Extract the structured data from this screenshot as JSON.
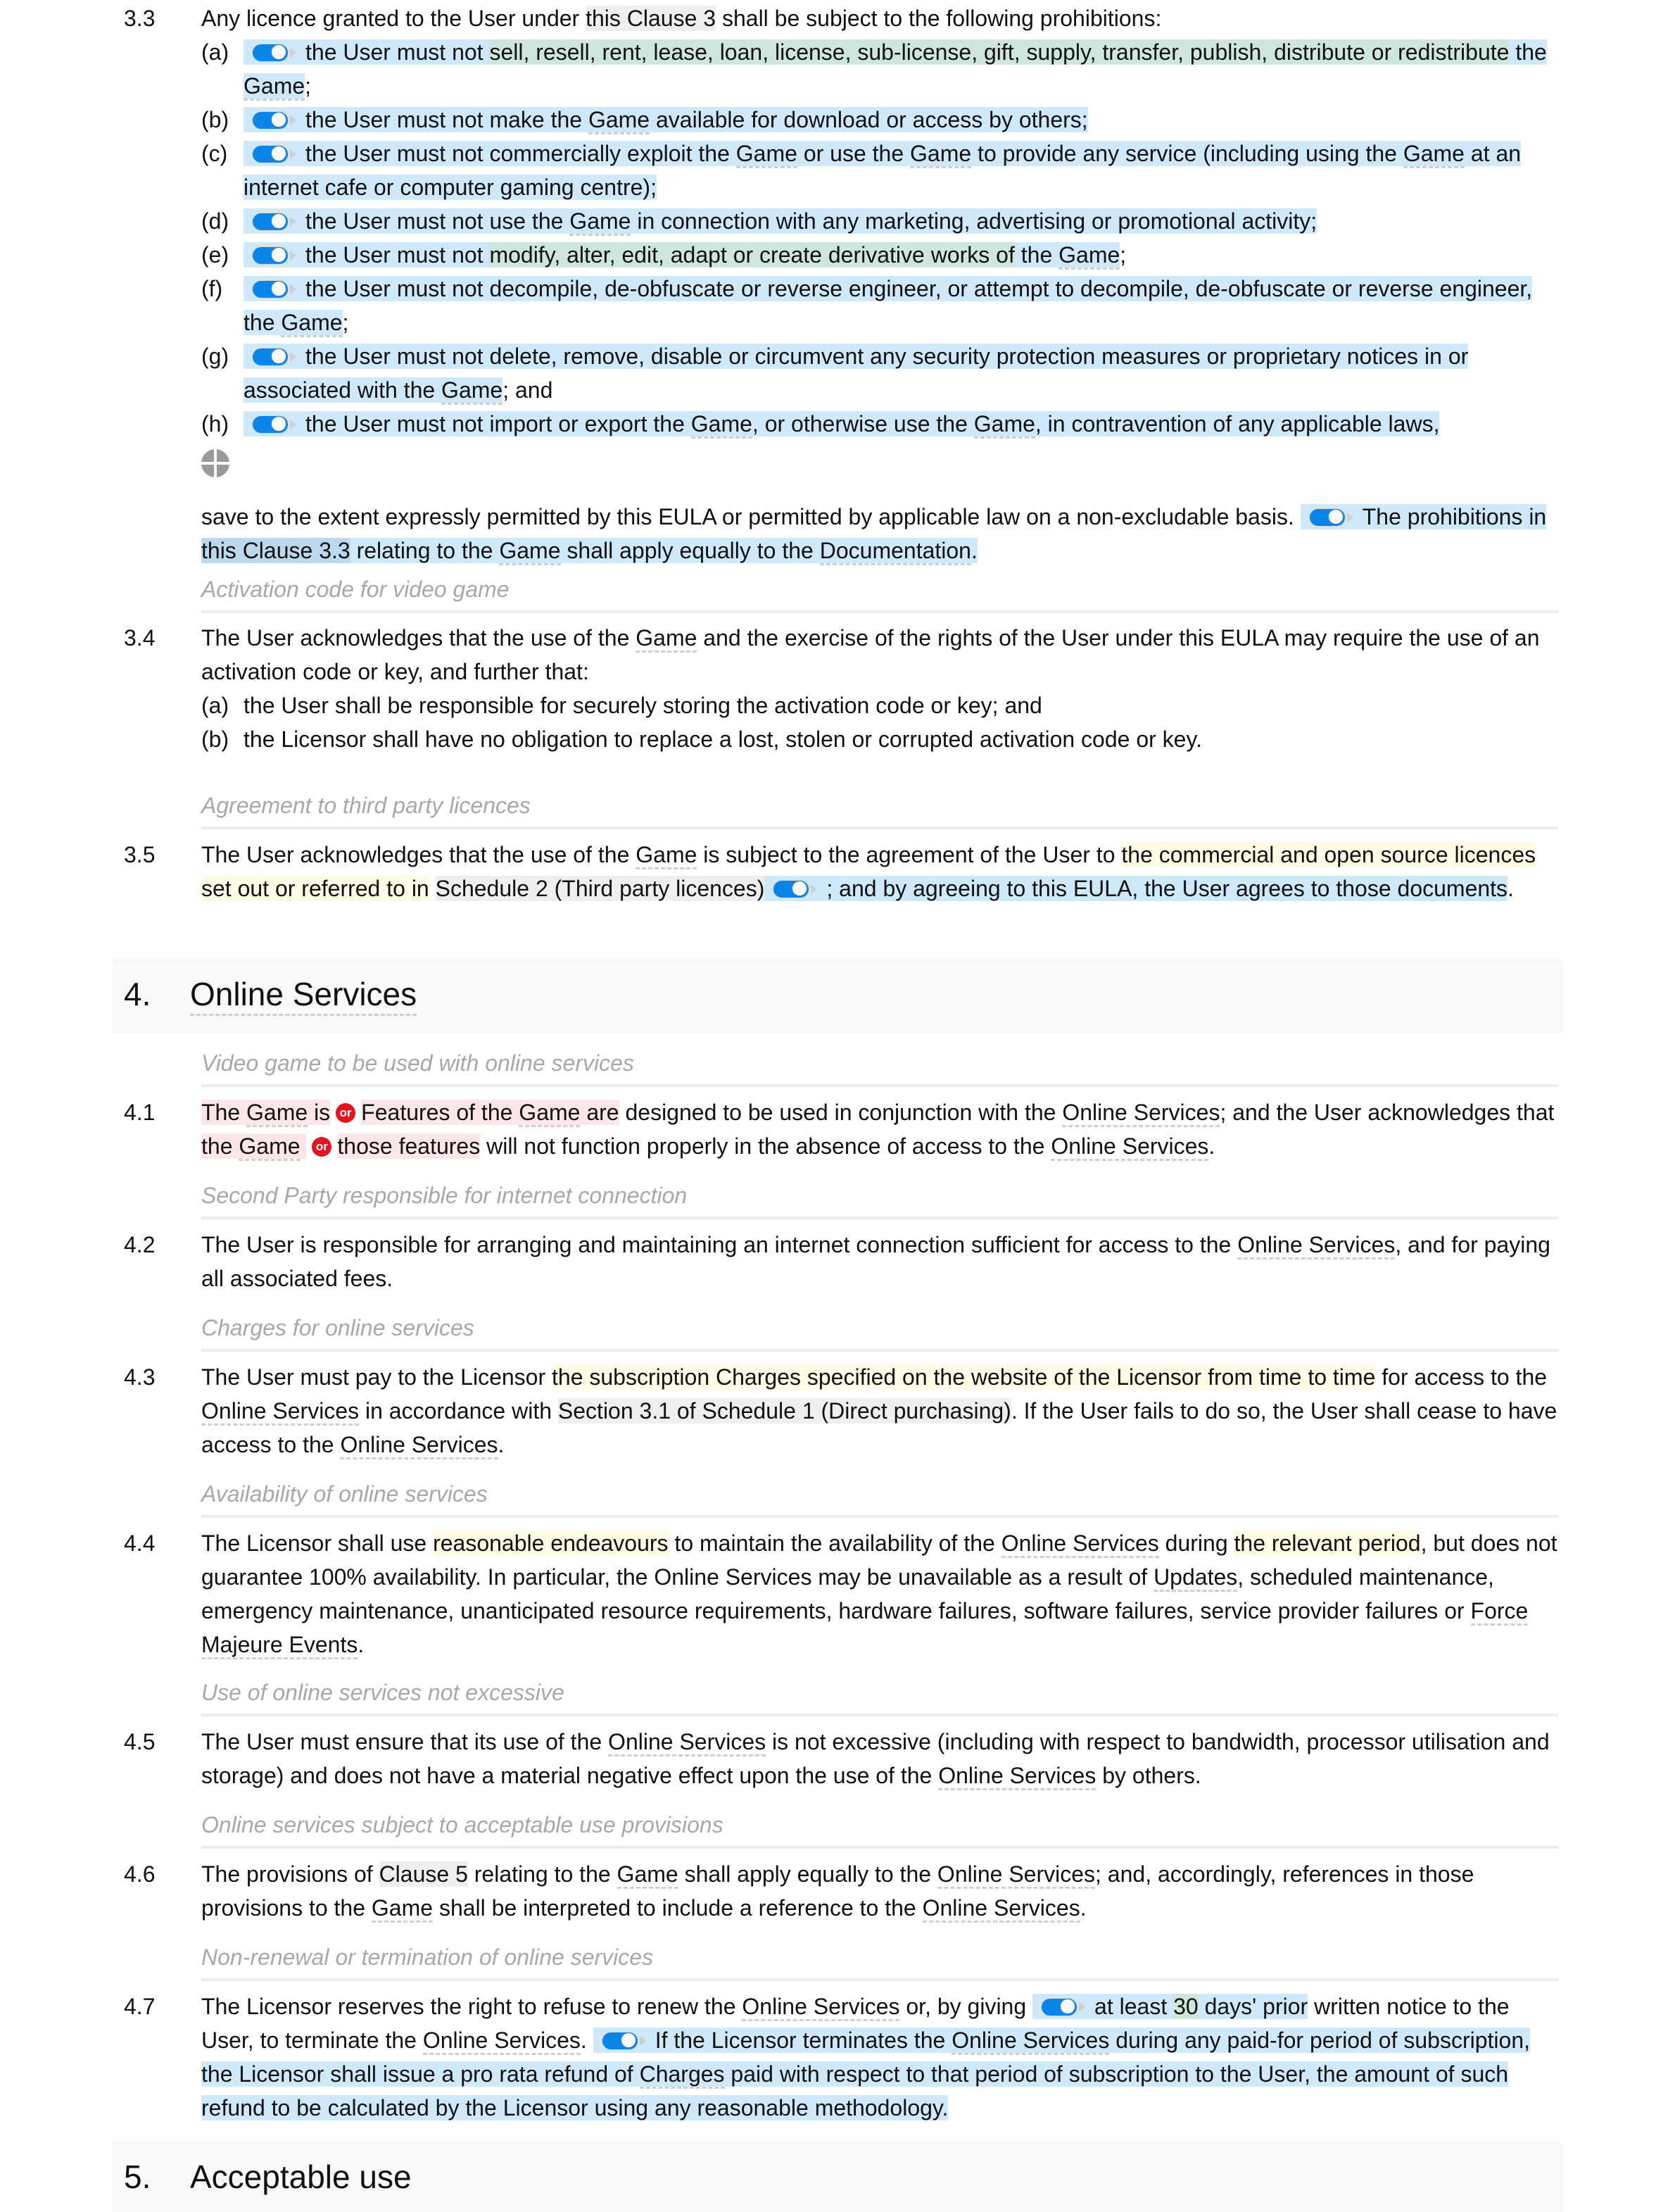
{
  "clause_3_3": {
    "number": "3.3",
    "intro_pre": "Any licence granted to the User under ",
    "intro_ref": "this Clause 3",
    "intro_post": " shall be subject to the following prohibitions:",
    "items": [
      {
        "label": "(a)",
        "pre": "the User must not ",
        "green": "sell, resell, rent, lease, loan, license, sub-license, gift, supply, transfer, publish, distribute or redistribute",
        "mid": " the ",
        "def": "Game",
        "post": ";"
      },
      {
        "label": "(b)",
        "pre": "the User must not make the ",
        "def": "Game",
        "post": " available for download or access by others;"
      },
      {
        "label": "(c)",
        "pre": "the User must not commercially exploit the ",
        "def": "Game",
        "mid": " or use the ",
        "def2": "Game",
        "mid2": " to provide any service (including using the ",
        "def3": "Game",
        "post": " at an internet cafe or computer gaming centre);"
      },
      {
        "label": "(d)",
        "pre": "the User must not use the ",
        "def": "Game",
        "post": " in connection with any marketing, advertising or promotional activity;"
      },
      {
        "label": "(e)",
        "pre": "the User must not ",
        "green": "modify, alter, edit, adapt or create derivative works of",
        "mid": " the ",
        "def": "Game",
        "post": ";"
      },
      {
        "label": "(f)",
        "pre": "the User must not decompile, de-obfuscate or reverse engineer, or attempt to decompile, de-obfuscate or reverse engineer, the ",
        "def": "Game",
        "post": ";"
      },
      {
        "label": "(g)",
        "pre": "the User must not delete, remove, disable or circumvent any security protection measures or proprietary notices in or associated with the ",
        "def": "Game",
        "post": "; and"
      },
      {
        "label": "(h)",
        "pre": "the User must not import or export the ",
        "def": "Game",
        "mid": ", or otherwise use the ",
        "def2": "Game",
        "post": ", in contravention of any applicable laws,"
      }
    ],
    "closing_plain": "save to the extent expressly permitted by this EULA or permitted by applicable law on a non-excludable basis.",
    "closing_opt_pre": "The prohibitions in ",
    "closing_opt_ref": "this Clause 3.3",
    "closing_opt_mid": " relating to the ",
    "closing_opt_def": "Game",
    "closing_opt_mid2": " shall apply equally to the ",
    "closing_opt_def2": "Documentation",
    "closing_opt_post": "."
  },
  "subheads": {
    "s3_4": "Activation code for video game",
    "s3_5": "Agreement to third party licences",
    "s4_1": "Video game to be used with online services",
    "s4_2": "Second Party responsible for internet connection",
    "s4_3": "Charges for online services",
    "s4_4": "Availability of online services",
    "s4_5": "Use of online services not excessive",
    "s4_6": "Online services subject to acceptable use provisions",
    "s4_7": "Non-renewal or termination of online services"
  },
  "clause_3_4": {
    "number": "3.4",
    "pre": "The User acknowledges that the use of the ",
    "def": "Game",
    "post": " and the exercise of the rights of the User under this EULA may require the use of an activation code or key, and further that:",
    "items": [
      {
        "label": "(a)",
        "text": "the User shall be responsible for securely storing the activation code or key; and"
      },
      {
        "label": "(b)",
        "text": "the Licensor shall have no obligation to replace a lost, stolen or corrupted activation code or key."
      }
    ]
  },
  "clause_3_5": {
    "number": "3.5",
    "pre": "The User acknowledges that the use of the ",
    "def": "Game",
    "mid": " is subject to the agreement of the User to ",
    "yellow": "the commercial and open source licences set out or referred to in",
    "ref": "Schedule 2 (Third party licences)",
    "opt": "; and by agreeing to this EULA, the User agrees to those documents",
    "post": "."
  },
  "section_4": {
    "number": "4.",
    "title": "Online Services"
  },
  "clause_4_1": {
    "number": "4.1",
    "alt1a": "The ",
    "alt1a_def": "Game",
    "alt1a_post": " is",
    "or_label": "or",
    "alt1b": "Features of the ",
    "alt1b_def": "Game",
    "alt1b_post": " are",
    "mid": " designed to be used in conjunction with the ",
    "def_os": "Online Services",
    "mid2": "; and the User acknowledges that ",
    "alt2a": "the ",
    "alt2a_def": "Game",
    "alt2b": "those features",
    "mid3": " will not function properly in the absence of access to the ",
    "def_os2": "Online Services",
    "post": "."
  },
  "clause_4_2": {
    "number": "4.2",
    "pre": "The User is responsible for arranging and maintaining an internet connection sufficient for access to the ",
    "def": "Online Services",
    "post": ", and for paying all associated fees."
  },
  "clause_4_3": {
    "number": "4.3",
    "pre": "The User must pay to the Licensor ",
    "yellow": "the subscription Charges specified on the website of the Licensor from time to time",
    "mid": " for access to the ",
    "def": "Online Services",
    "mid2": " in accordance with ",
    "ref": "Section 3.1 of Schedule 1 (Direct purchasing)",
    "mid3": ". If the User fails to do so, the User shall cease to have access to the ",
    "def2": "Online Services",
    "post": "."
  },
  "clause_4_4": {
    "number": "4.4",
    "pre": "The Licensor shall use ",
    "yellow": "reasonable endeavours",
    "mid": " to maintain the availability of the ",
    "def": "Online Services",
    "mid2": " during ",
    "yellow2": "the relevant period",
    "mid3": ", but does not guarantee 100% availability. In particular, the Online Services may be unavailable as a result of ",
    "def2": "Updates",
    "mid4": ", scheduled maintenance, emergency maintenance, unanticipated resource requirements, hardware failures, software failures, service provider failures or ",
    "def3": "Force Majeure Events",
    "post": "."
  },
  "clause_4_5": {
    "number": "4.5",
    "pre": "The User must ensure that its use of the ",
    "def": "Online Services",
    "mid": " is not excessive (including with respect to bandwidth, processor utilisation and storage) and does not have a material negative effect upon the use of the ",
    "def2": "Online Services",
    "post": " by others."
  },
  "clause_4_6": {
    "number": "4.6",
    "pre": "The provisions of ",
    "ref": "Clause 5",
    "mid": " relating to the ",
    "def": "Game",
    "mid2": " shall apply equally to the ",
    "def2": "Online Services",
    "mid3": "; and, accordingly, references in those provisions to the ",
    "def3": "Game",
    "mid4": " shall be interpreted to include a reference to the ",
    "def4": "Online Services",
    "post": "."
  },
  "clause_4_7": {
    "number": "4.7",
    "pre": "The Licensor reserves the right to refuse to renew the ",
    "def": "Online Services",
    "mid": " or, by giving ",
    "opt1_pre": "at least ",
    "opt1_num": "30",
    "opt1_post": " days' prior",
    "mid2": " written notice to the User, to terminate the ",
    "def2": "Online Services",
    "mid3": ".",
    "opt2_pre": "If the Licensor terminates the ",
    "opt2_def": "Online Services",
    "opt2_mid": " during any paid-for period of subscription, the Licensor shall issue a pro rata refund of ",
    "opt2_def2": "Charges",
    "opt2_post": " paid with respect to that period of subscription to the User, the amount of such refund to be calculated by the Licensor using any reasonable methodology."
  },
  "section_5": {
    "number": "5.",
    "title": "Acceptable use"
  },
  "colors": {
    "optional_highlight": "#cfe8fa",
    "variant_highlight": "#d3ebe2",
    "reference_highlight": "#efefef",
    "editable_highlight": "#fefce6",
    "alternative_highlight": "#fde6e8",
    "toggle_on": "#0a84e6",
    "or_badge": "#e3141e"
  }
}
